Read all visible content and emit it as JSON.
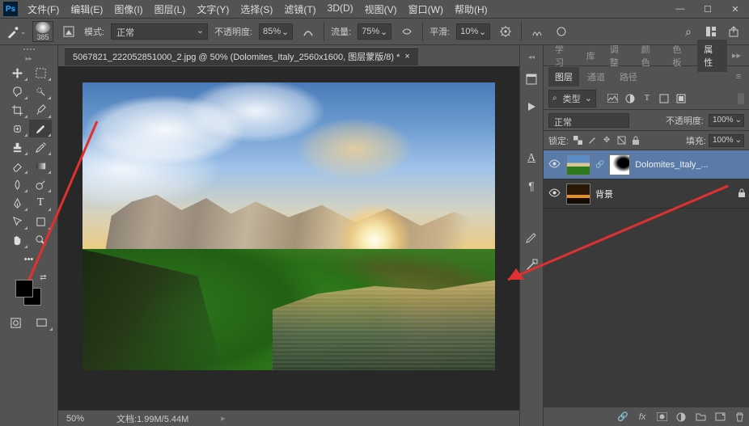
{
  "app": {
    "logo": "Ps"
  },
  "menu": [
    {
      "id": "file",
      "label": "文件(F)"
    },
    {
      "id": "edit",
      "label": "编辑(E)"
    },
    {
      "id": "image",
      "label": "图像(I)"
    },
    {
      "id": "layer",
      "label": "图层(L)"
    },
    {
      "id": "type",
      "label": "文字(Y)"
    },
    {
      "id": "select",
      "label": "选择(S)"
    },
    {
      "id": "filter",
      "label": "滤镜(T)"
    },
    {
      "id": "3d",
      "label": "3D(D)"
    },
    {
      "id": "view",
      "label": "视图(V)"
    },
    {
      "id": "window",
      "label": "窗口(W)"
    },
    {
      "id": "help",
      "label": "帮助(H)"
    }
  ],
  "options": {
    "brush_size": "385",
    "mode_label": "模式:",
    "mode_value": "正常",
    "opacity_label": "不透明度:",
    "opacity_value": "85%",
    "flow_label": "流量:",
    "flow_value": "75%",
    "smooth_label": "平滑:",
    "smooth_value": "10%"
  },
  "document": {
    "tab_title": "5067821_222052851000_2.jpg @ 50% (Dolomites_Italy_2560x1600, 图层蒙版/8) *",
    "zoom": "50%",
    "status_label": "文档:",
    "status_value": "1.99M/5.44M"
  },
  "panels": {
    "top_tabs": [
      "学习",
      "库",
      "调整",
      "颜色",
      "色板",
      "属性"
    ],
    "top_active": 5,
    "mid_tabs": [
      "图层",
      "通道",
      "路径"
    ],
    "mid_active": 0,
    "filter_label": "类型",
    "blend_mode": "正常",
    "opacity_label": "不透明度:",
    "opacity_value": "100%",
    "lock_label": "锁定:",
    "fill_label": "填充:",
    "fill_value": "100%"
  },
  "layers": [
    {
      "name": "Dolomites_Italy_...",
      "has_mask": true,
      "visible": true,
      "selected": true,
      "locked": false
    },
    {
      "name": "背景",
      "has_mask": false,
      "visible": true,
      "selected": false,
      "locked": true
    }
  ],
  "search_glyph": "⌕"
}
